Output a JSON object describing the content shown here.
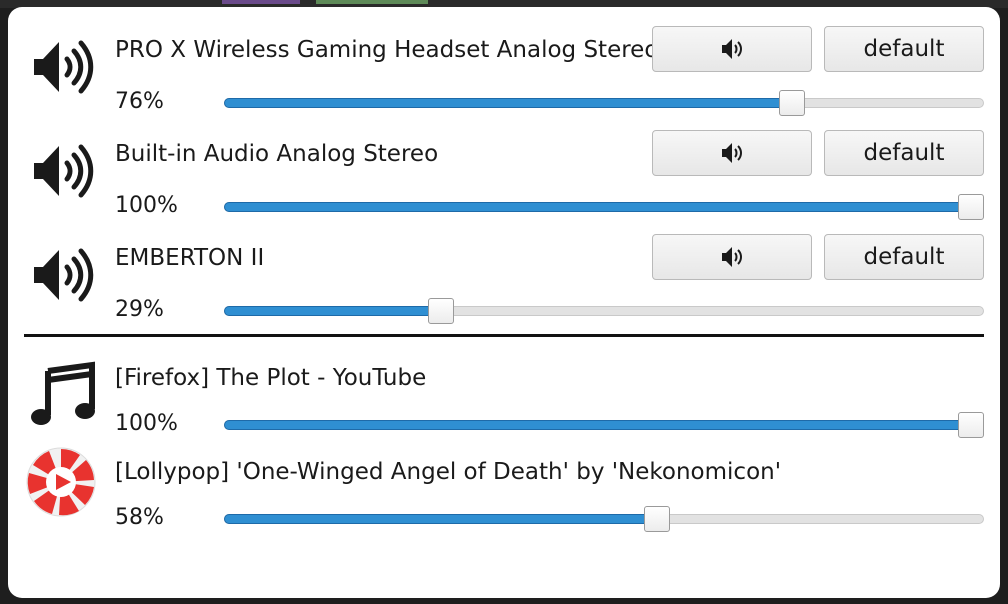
{
  "colors": {
    "accent": "#2f8fd2",
    "track": "#e2e2e2",
    "icon": "#1a1a1a",
    "lollypop_red": "#e8332f"
  },
  "outputs": [
    {
      "icon": "speaker-icon",
      "name": "PRO X Wireless Gaming Headset Analog Stereo",
      "percent_label": "76%",
      "volume": 0.76,
      "mute_icon": "speaker-icon",
      "default_label": "default"
    },
    {
      "icon": "speaker-icon",
      "name": "Built-in Audio Analog Stereo",
      "percent_label": "100%",
      "volume": 1.0,
      "mute_icon": "speaker-icon",
      "default_label": "default"
    },
    {
      "icon": "speaker-icon",
      "name": "EMBERTON II",
      "percent_label": "29%",
      "volume": 0.29,
      "mute_icon": "speaker-icon",
      "default_label": "default"
    }
  ],
  "streams": [
    {
      "icon": "music-note-icon",
      "name": "[Firefox] The Plot - YouTube",
      "percent_label": "100%",
      "volume": 1.0
    },
    {
      "icon": "lollypop-app-icon",
      "name": "[Lollypop] 'One-Winged Angel of Death' by 'Nekonomicon'",
      "percent_label": "58%",
      "volume": 0.58
    }
  ]
}
